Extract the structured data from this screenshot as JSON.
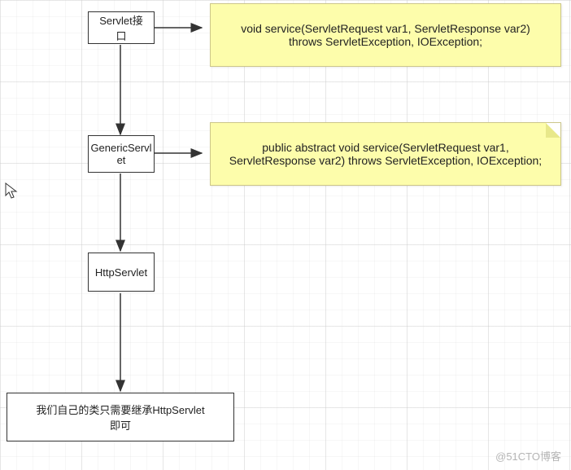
{
  "nodes": {
    "servlet_interface": "Servlet接口",
    "generic_servlet": "GenericServl\net",
    "http_servlet": "HttpServlet",
    "own_class": "我们自己的类只需要继承HttpServlet\n即可"
  },
  "notes": {
    "servlet_note": "void service(ServletRequest var1, ServletResponse var2) throws ServletException, IOException;",
    "generic_note": "public abstract void service(ServletRequest var1, ServletResponse var2) throws ServletException, IOException;"
  },
  "watermark": "@51CTO博客"
}
